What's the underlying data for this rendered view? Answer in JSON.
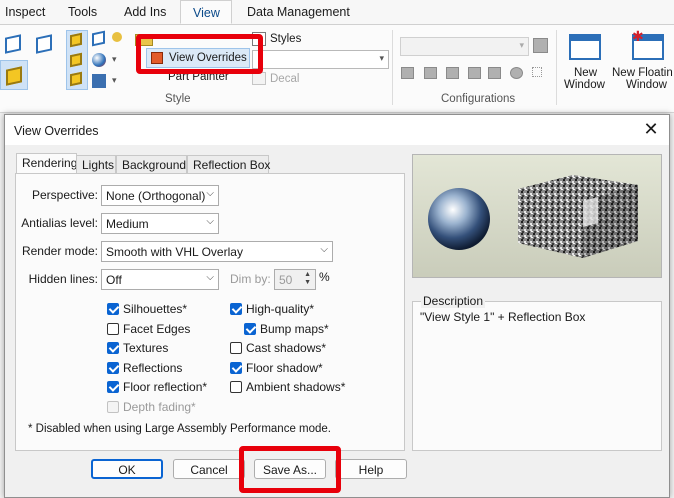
{
  "ribbon": {
    "tabs": [
      {
        "label": "Inspect"
      },
      {
        "label": "Tools"
      },
      {
        "label": "Add Ins"
      },
      {
        "label": "View"
      },
      {
        "label": "Data Management"
      }
    ],
    "active_tab": "View",
    "view_overrides_label": "View Overrides",
    "styles_label": "Styles",
    "part_painter_label": "Part Painter",
    "decal_label": "Decal",
    "style_group_label": "Style",
    "configurations_group_label": "Configurations",
    "new_window_label": [
      "New",
      "Window"
    ],
    "new_floating_window_label": [
      "New Floatin",
      "Window"
    ]
  },
  "dialog": {
    "title": "View Overrides",
    "tabs": [
      "Rendering",
      "Lights",
      "Background",
      "Reflection Box"
    ],
    "active_tab": "Rendering",
    "fields": {
      "perspective": {
        "label": "Perspective:",
        "value": "None (Orthogonal)"
      },
      "antialias": {
        "label": "Antialias level:",
        "value": "Medium"
      },
      "render_mode": {
        "label": "Render mode:",
        "value": "Smooth with VHL Overlay"
      },
      "hidden_lines": {
        "label": "Hidden lines:",
        "value": "Off"
      },
      "dim_by": {
        "label": "Dim by:",
        "value": "50",
        "unit": "%"
      }
    },
    "checkboxes": {
      "silhouettes": {
        "label": "Silhouettes*",
        "checked": true
      },
      "facet_edges": {
        "label": "Facet Edges",
        "checked": false
      },
      "textures": {
        "label": "Textures",
        "checked": true
      },
      "reflections": {
        "label": "Reflections",
        "checked": true
      },
      "floor_reflection": {
        "label": "Floor reflection*",
        "checked": true
      },
      "depth_fading": {
        "label": "Depth fading*",
        "checked": false,
        "disabled": true
      },
      "high_quality": {
        "label": "High-quality*",
        "checked": true
      },
      "bump_maps": {
        "label": "Bump maps*",
        "checked": true
      },
      "cast_shadows": {
        "label": "Cast shadows*",
        "checked": false
      },
      "floor_shadow": {
        "label": "Floor shadow*",
        "checked": true
      },
      "ambient_shadows": {
        "label": "Ambient shadows*",
        "checked": false
      }
    },
    "note": "* Disabled when using Large Assembly Performance mode.",
    "description_header": "Description",
    "description_value": "\"View Style 1\" + Reflection Box",
    "buttons": {
      "ok": "OK",
      "cancel": "Cancel",
      "save_as": "Save As...",
      "help": "Help"
    }
  },
  "colors": {
    "highlight_red": "#e8000b",
    "accent_blue": "#0a64d2",
    "ribbon_blue": "#2c6fb8"
  }
}
